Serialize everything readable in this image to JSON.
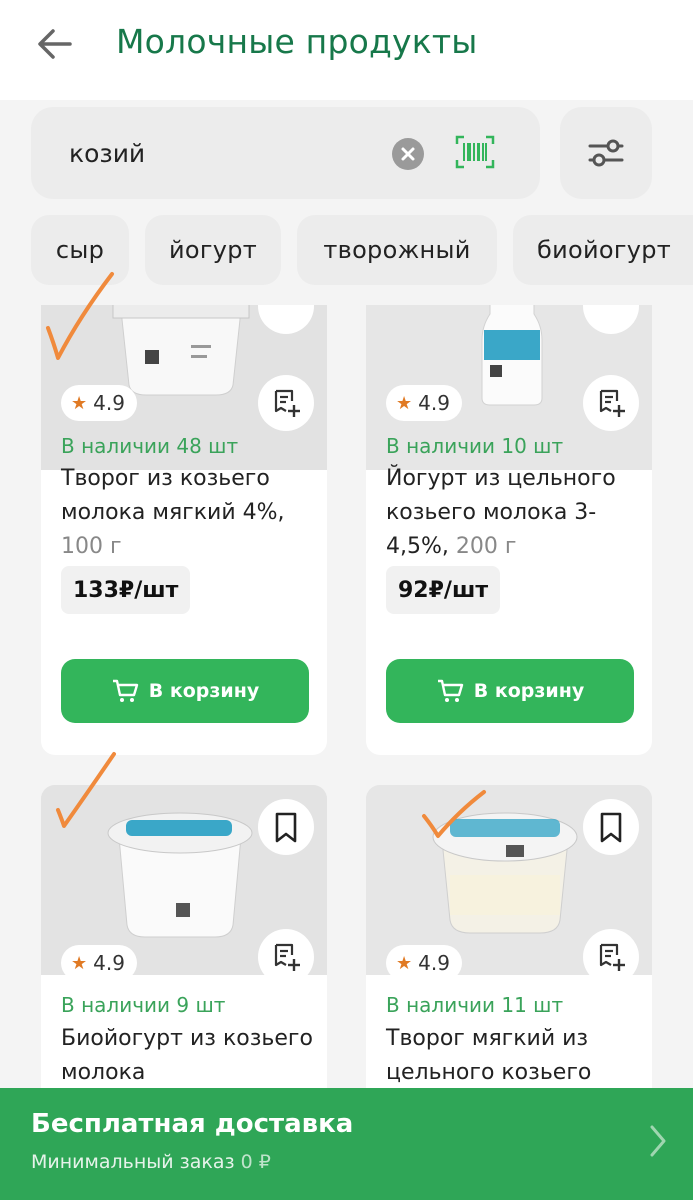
{
  "header": {
    "title": "Молочные продукты"
  },
  "search": {
    "value": "козий"
  },
  "chips": [
    "сыр",
    "йогурт",
    "творожный",
    "биойогурт"
  ],
  "products": [
    {
      "rating": "4.9",
      "stock": "В наличии 48 шт",
      "name": "Творог из козьего молока мягкий 4%,",
      "weight": "100 г",
      "price": "133₽/шт",
      "cart_label": "В корзину"
    },
    {
      "rating": "4.9",
      "stock": "В наличии 10 шт",
      "name": "Йогурт из цельного козьего молока 3-4,5%,",
      "weight": "200 г",
      "price": "92₽/шт",
      "cart_label": "В корзину"
    },
    {
      "rating": "4.9",
      "stock": "В наличии 9 шт",
      "name": "Биойогурт из козьего молока",
      "weight": ""
    },
    {
      "rating": "4.9",
      "stock": "В наличии 11 шт",
      "name": "Творог мягкий из цельного козьего",
      "weight": ""
    }
  ],
  "delivery": {
    "title": "Бесплатная доставка",
    "min_label": "Минимальный заказ",
    "min_value": "0 ₽"
  },
  "colors": {
    "brand_green": "#17784a",
    "button_green": "#33b55b",
    "banner_green": "#2fa657",
    "stock_green": "#3aa35a",
    "star": "#e07a24",
    "check_mark": "#f08a3c"
  }
}
